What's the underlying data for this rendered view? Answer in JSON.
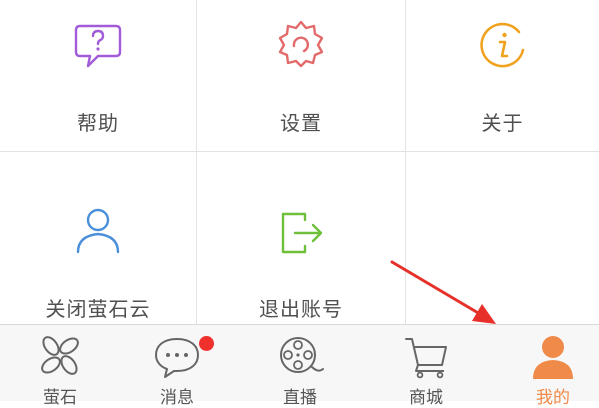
{
  "grid": {
    "items": [
      {
        "label": "帮助",
        "icon": "help-icon"
      },
      {
        "label": "设置",
        "icon": "settings-gear-icon"
      },
      {
        "label": "关于",
        "icon": "info-icon"
      },
      {
        "label": "关闭萤石云",
        "icon": "user-icon"
      },
      {
        "label": "退出账号",
        "icon": "logout-icon"
      }
    ]
  },
  "tabbar": {
    "tabs": [
      {
        "label": "萤石",
        "icon": "ezviz-petal-icon"
      },
      {
        "label": "消息",
        "icon": "message-bubble-icon",
        "badge": true
      },
      {
        "label": "直播",
        "icon": "film-reel-icon"
      },
      {
        "label": "商城",
        "icon": "shopping-cart-icon"
      },
      {
        "label": "我的",
        "icon": "person-icon",
        "active": true
      }
    ]
  },
  "colors": {
    "help": "#a25bd9",
    "settings": "#e36a6a",
    "info": "#f0a21f",
    "user": "#4a8fd9",
    "logout": "#6fbf3a",
    "active_tab": "#f08a48",
    "badge": "#f0302c",
    "arrow": "#e8302a"
  }
}
